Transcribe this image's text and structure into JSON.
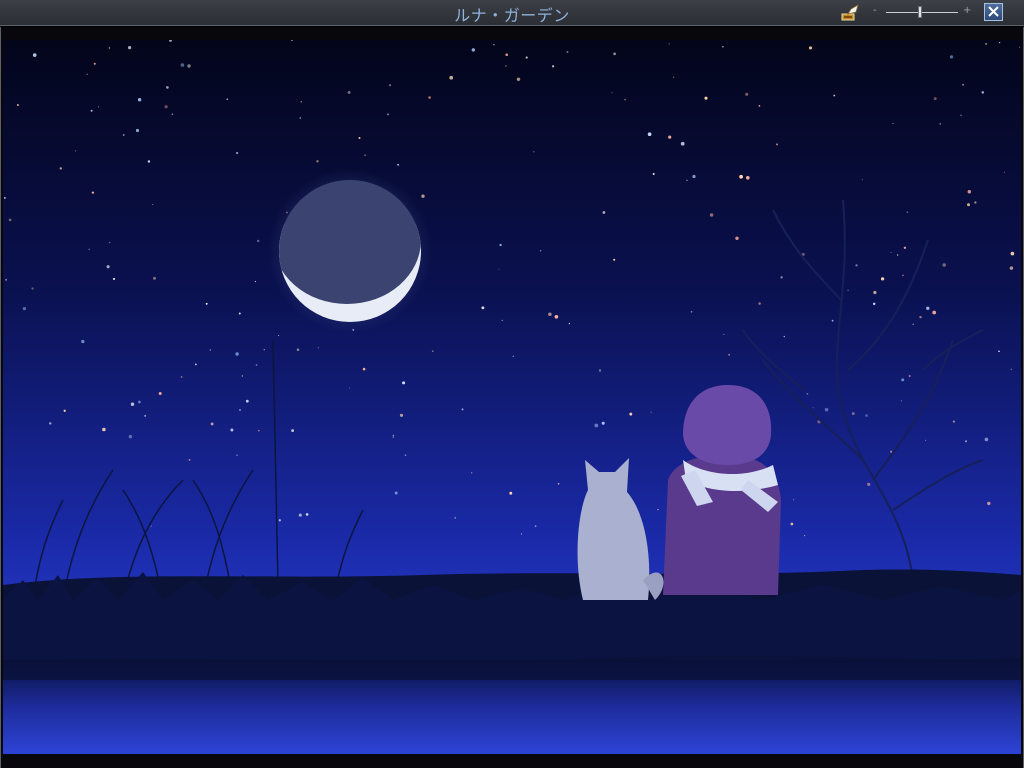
{
  "window": {
    "title": "ルナ・ガーデン"
  },
  "toolbar": {
    "music_icon": "gramophone-icon",
    "volume_minus": "-",
    "volume_plus": "+",
    "volume_level": 0.47,
    "close_icon": "close-icon"
  },
  "colors": {
    "titlebar": "#34373c",
    "title_text": "#8fb3dd",
    "sky_top": "#03051a",
    "sky_bottom": "#2c3fd6",
    "close_button": "#3b5a88"
  }
}
